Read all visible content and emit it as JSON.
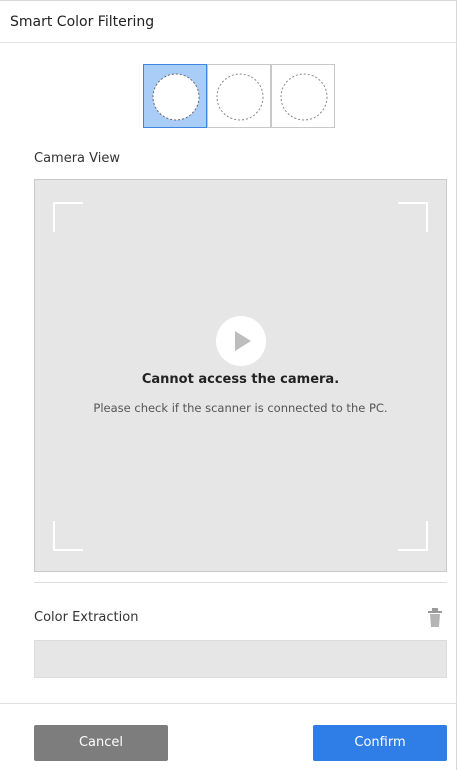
{
  "header": {
    "title": "Smart Color Filtering"
  },
  "mode_selector": {
    "options": [
      {
        "name": "mode-option-1",
        "selected": true
      },
      {
        "name": "mode-option-2",
        "selected": false
      },
      {
        "name": "mode-option-3",
        "selected": false
      }
    ]
  },
  "camera": {
    "label": "Camera View",
    "error_title": "Cannot access the camera.",
    "error_message": "Please check if the scanner is connected to the PC.",
    "play_icon": "play-icon"
  },
  "extraction": {
    "label": "Color Extraction",
    "delete_icon": "trash-icon"
  },
  "footer": {
    "cancel_label": "Cancel",
    "confirm_label": "Confirm"
  },
  "colors": {
    "accent": "#2f7de6",
    "selected_bg": "#a9cdf7",
    "cancel_bg": "#7d7d7d",
    "camera_bg": "#e6e6e6"
  }
}
